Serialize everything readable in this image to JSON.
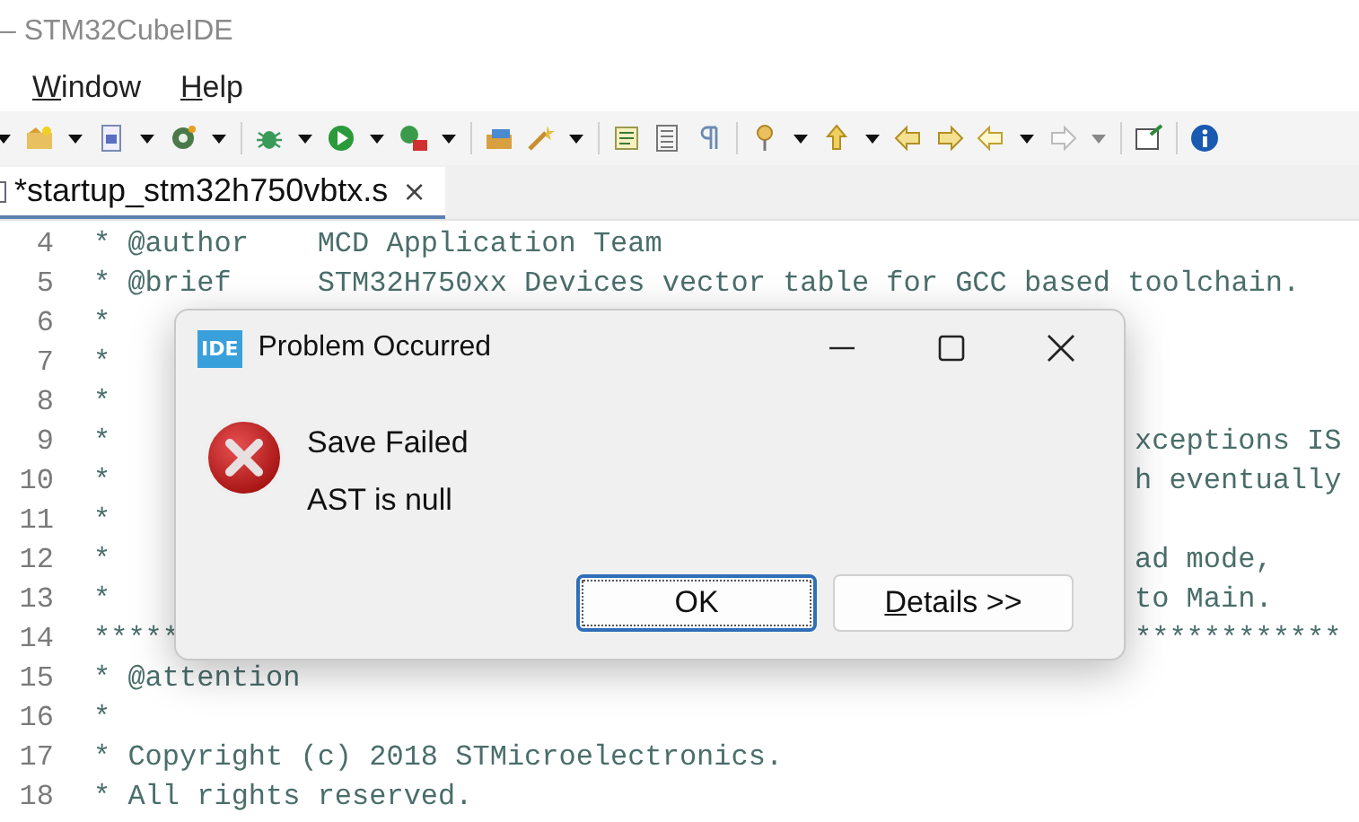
{
  "window": {
    "title": "– STM32CubeIDE"
  },
  "menu": [
    {
      "mnemonic": "W",
      "rest": "indow"
    },
    {
      "mnemonic": "H",
      "rest": "elp"
    }
  ],
  "tabs": [
    {
      "label": "*startup_stm32h750vbtx.s",
      "close": "×",
      "selected": true
    }
  ],
  "code_lines": [
    {
      "number": "4",
      "text": "* @author    MCD Application Team"
    },
    {
      "number": "5",
      "text": "* @brief     STM32H750xx Devices vector table for GCC based toolchain."
    },
    {
      "number": "6",
      "text": "*"
    },
    {
      "number": "7",
      "text": "*"
    },
    {
      "number": "8",
      "text": "*"
    },
    {
      "number": "9",
      "text": "*",
      "tail": "xceptions IS"
    },
    {
      "number": "10",
      "text": "*",
      "tail": "h eventually"
    },
    {
      "number": "11",
      "text": "*"
    },
    {
      "number": "12",
      "text": "*",
      "tail": "ad mode,"
    },
    {
      "number": "13",
      "text": "*",
      "tail": "to Main."
    },
    {
      "number": "14",
      "text": "*****",
      "tail": "************"
    },
    {
      "number": "15",
      "text": "* @attention"
    },
    {
      "number": "16",
      "text": "*"
    },
    {
      "number": "17",
      "text": "* Copyright (c) 2018 STMicroelectronics."
    },
    {
      "number": "18",
      "text": "* All rights reserved."
    }
  ],
  "dialog": {
    "app_badge": "IDE",
    "title": "Problem Occurred",
    "kind": "error",
    "messages": [
      "Save Failed",
      "AST is null"
    ],
    "buttons": [
      {
        "rest": "OK",
        "default": true
      },
      {
        "mnemonic": "D",
        "rest": "etails >>",
        "default": false
      }
    ]
  }
}
